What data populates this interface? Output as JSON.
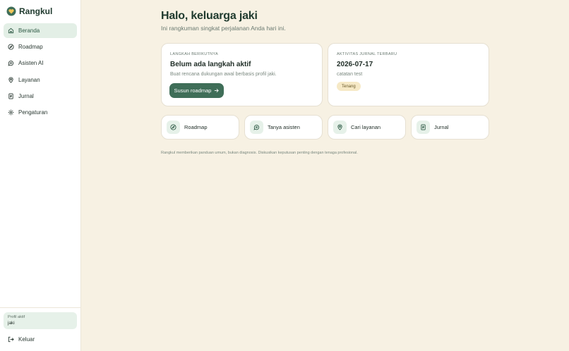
{
  "brand": {
    "name": "Rangkul"
  },
  "sidebar": {
    "items": [
      {
        "label": "Beranda",
        "icon": "home-icon",
        "active": true
      },
      {
        "label": "Roadmap",
        "icon": "compass-icon",
        "active": false
      },
      {
        "label": "Asisten AI",
        "icon": "chat-icon",
        "active": false
      },
      {
        "label": "Layanan",
        "icon": "map-pin-icon",
        "active": false
      },
      {
        "label": "Jurnal",
        "icon": "journal-icon",
        "active": false
      },
      {
        "label": "Pengaturan",
        "icon": "gear-icon",
        "active": false
      }
    ],
    "profile": {
      "label": "Profil aktif",
      "name": "jaki"
    },
    "logout_label": "Keluar"
  },
  "header": {
    "greeting": "Halo, keluarga jaki",
    "subtitle": "Ini rangkuman singkat perjalanan Anda hari ini."
  },
  "next_step": {
    "eyebrow": "LANGKAH BERIKUTNYA",
    "title": "Belum ada langkah aktif",
    "description": "Buat rencana dukungan awal berbasis profil jaki.",
    "button_label": "Susun roadmap"
  },
  "journal_activity": {
    "eyebrow": "AKTIVITAS JURNAL TERBARU",
    "date": "2026-07-17",
    "note": "catatan test",
    "mood": "Tenang"
  },
  "quick_links": [
    {
      "label": "Roadmap",
      "icon": "compass-icon"
    },
    {
      "label": "Tanya asisten",
      "icon": "chat-icon"
    },
    {
      "label": "Cari layanan",
      "icon": "map-pin-icon"
    },
    {
      "label": "Jurnal",
      "icon": "journal-icon"
    }
  ],
  "disclaimer": "Rangkul memberikan panduan umum, bukan diagnosis. Diskusikan keputusan penting dengan tenaga profesional.",
  "colors": {
    "background": "#f7f1e3",
    "primary": "#3f6e58",
    "active_nav": "#e3efe6",
    "mood_badge": "#f6e9c6"
  }
}
